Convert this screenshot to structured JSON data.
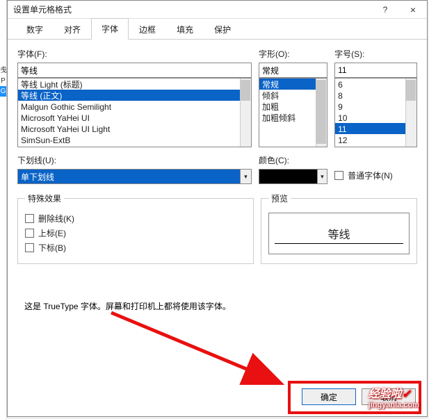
{
  "window": {
    "title": "设置单元格格式",
    "help": "?",
    "close": "×"
  },
  "tabs": [
    "数字",
    "对齐",
    "字体",
    "边框",
    "填充",
    "保护"
  ],
  "active_tab": 2,
  "labels": {
    "font": "字体(F):",
    "style": "字形(O):",
    "size": "字号(S):",
    "underline": "下划线(U):",
    "color": "颜色(C):",
    "normal_font": "普通字体(N)",
    "effects": "特殊效果",
    "strike": "删除线(K)",
    "super": "上标(E)",
    "sub": "下标(B)",
    "preview": "预览"
  },
  "font": {
    "value": "等线",
    "list": [
      "等线 Light (标题)",
      "等线 (正文)",
      "Malgun Gothic Semilight",
      "Microsoft YaHei UI",
      "Microsoft YaHei UI Light",
      "SimSun-ExtB"
    ],
    "selected_index": 1
  },
  "style": {
    "value": "常规",
    "list": [
      "常规",
      "倾斜",
      "加粗",
      "加粗倾斜"
    ],
    "selected_index": 0
  },
  "size": {
    "value": "11",
    "list": [
      "6",
      "8",
      "9",
      "10",
      "11",
      "12"
    ],
    "selected_index": 4
  },
  "underline": {
    "value": "单下划线"
  },
  "color": {
    "value": ""
  },
  "preview_text": "等线",
  "footnote": "这是 TrueType 字体。屏幕和打印机上都将使用该字体。",
  "buttons": {
    "ok": "确定",
    "cancel": "取消"
  },
  "watermark": {
    "main": "经验啦",
    "sub": "jingyanla.com"
  }
}
